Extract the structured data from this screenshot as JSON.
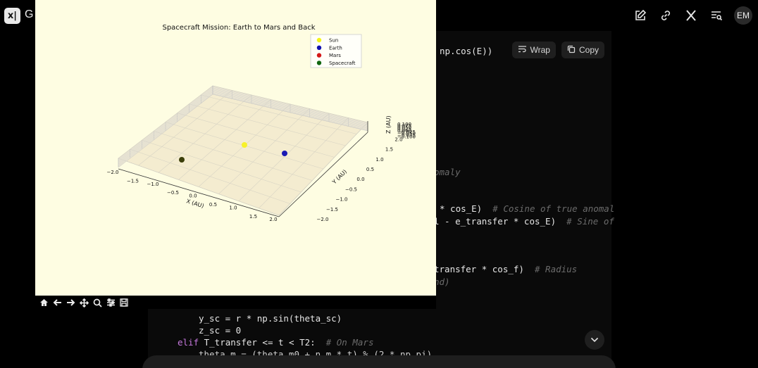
{
  "topbar": {
    "app_letter": "G",
    "avatar_initials": "EM"
  },
  "code": {
    "toolbar": {
      "wrap_label": "Wrap",
      "copy_label": "Copy"
    },
    "lines": {
      "l1": "np.cos(E))",
      "l2": "omaly",
      "l3_code": "* cos_E)  ",
      "l3_comment": "# Cosine of true anomal",
      "l4_code": "l - e_transfer * cos_E)  ",
      "l4_comment": "# Sine of",
      "l5_code": "transfer * cos_f)  ",
      "l5_comment": "# Radius",
      "l6_comment": "nd)",
      "l7": "y_sc = r * np.sin(theta_sc)",
      "l8": "z_sc = 0",
      "l9_kw": "elif",
      "l9_code": " T_transfer <= t < T2:  ",
      "l9_comment": "# On Mars",
      "l10": "theta_m = (theta_m0 + n_m * t) % (2 * np.pi)"
    }
  },
  "figure": {
    "title": "Spacecraft Mission: Earth to Mars and Back",
    "legend": [
      {
        "label": "Sun",
        "color": "#f3f31a"
      },
      {
        "label": "Earth",
        "color": "#1010b0"
      },
      {
        "label": "Mars",
        "color": "#d41818"
      },
      {
        "label": "Spacecraft",
        "color": "#116611"
      }
    ],
    "x_axis": {
      "label": "X (AU)",
      "ticks": [
        "−2.0",
        "−1.5",
        "−1.0",
        "−0.5",
        "0.0",
        "0.5",
        "1.0",
        "1.5",
        "2.0"
      ]
    },
    "y_axis": {
      "label": "Y (AU)",
      "ticks": [
        "−2.0",
        "−1.5",
        "−1.0",
        "−0.5",
        "0.0",
        "0.5",
        "1.0",
        "1.5",
        "2.0"
      ]
    },
    "z_axis": {
      "label": "Z (AU)",
      "ticks": [
        "0.100",
        "0.075",
        "0.050",
        "0.025",
        "0.000",
        "−0.025",
        "−0.050",
        "−0.075",
        "−0.100"
      ]
    },
    "bodies": [
      {
        "name": "Sun",
        "color": "#f7f12a"
      },
      {
        "name": "Earth",
        "color": "#1a1ab4"
      },
      {
        "name": "Spacecraft",
        "color": "#3b3f0a"
      }
    ]
  }
}
